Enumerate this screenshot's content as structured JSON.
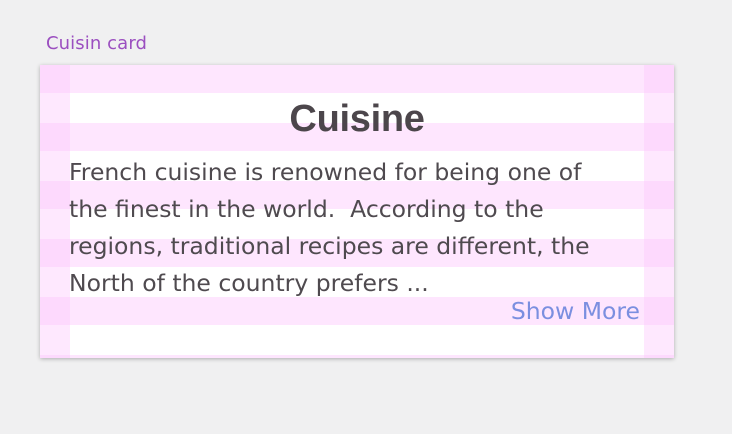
{
  "frame": {
    "label": "Cuisin card"
  },
  "card": {
    "title": "Cuisine",
    "body_lines": [
      "French cuisine is renowned for being one of",
      "the finest in the world.  According to the",
      "regions, traditional recipes are different, the",
      "North of the country prefers ..."
    ],
    "show_more_label": "Show More"
  },
  "colors": {
    "frame_label": "#9b4fc0",
    "title": "#4c464b",
    "body_text": "#4f4a4f",
    "link": "#7b8fe0",
    "grid_overlay": "#fcc8fc",
    "background": "#f0f0f1",
    "card": "#ffffff"
  }
}
